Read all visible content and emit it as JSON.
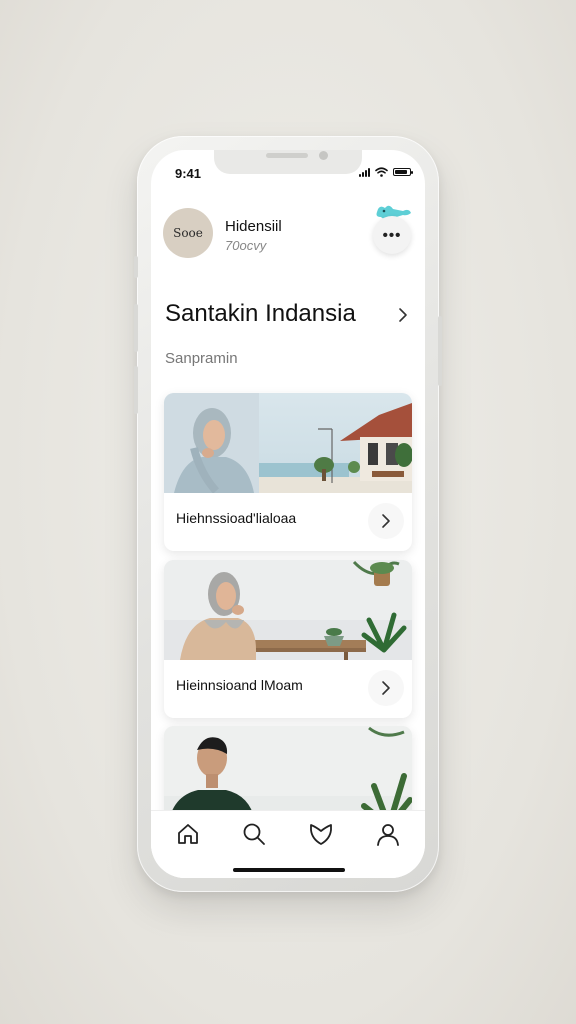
{
  "status_bar": {
    "time": "9:41"
  },
  "profile": {
    "avatar_text": "Sooe",
    "name": "Hidensiil",
    "subtitle": "70ocvy",
    "more_label": "•••"
  },
  "section": {
    "title": "Santakin Indansia",
    "subtitle": "Sanpramin"
  },
  "cards": [
    {
      "label": "Hiehnssioad'lialoaa",
      "image": "woman in hijab by seaside house"
    },
    {
      "label": "Hieinnsioand lMoam",
      "image": "woman in hijab at wooden table with plants"
    },
    {
      "label": "",
      "image": "man in dark sweater outdoors"
    }
  ],
  "tabbar": {
    "tabs": [
      {
        "icon": "home-icon"
      },
      {
        "icon": "search-icon"
      },
      {
        "icon": "heart-shield-icon"
      },
      {
        "icon": "profile-icon"
      }
    ]
  },
  "colors": {
    "background": "#e6e4de",
    "screen": "#ffffff",
    "avatar": "#d8cfc2",
    "sticker_accent": "#5ecfd6"
  }
}
